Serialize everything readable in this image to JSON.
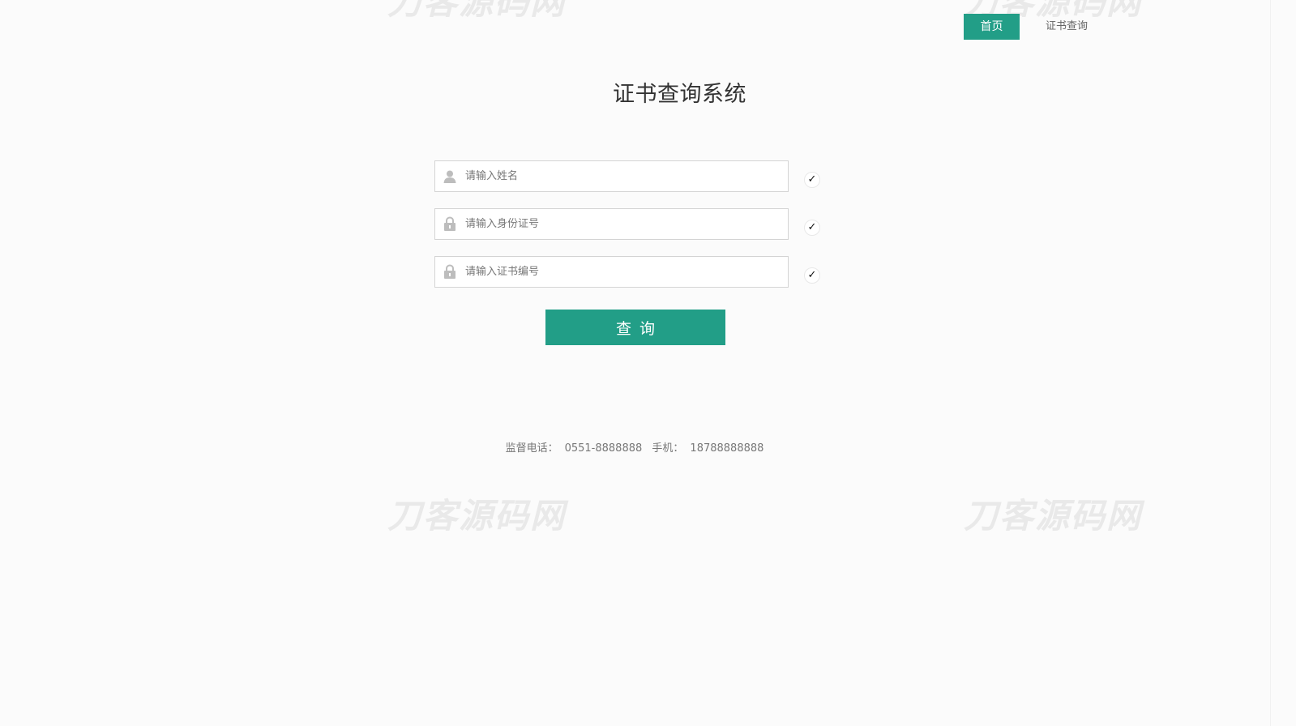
{
  "watermark": {
    "text": "刀客源码网"
  },
  "nav": {
    "home": "首页",
    "query": "证书查询"
  },
  "page": {
    "title": "证书查询系统"
  },
  "form": {
    "name": {
      "placeholder": "请输入姓名",
      "icon": "user-icon"
    },
    "id_number": {
      "placeholder": "请输入身份证号",
      "icon": "lock-icon"
    },
    "cert_number": {
      "placeholder": "请输入证书编号",
      "icon": "lock-icon"
    },
    "check_mark": "✓",
    "submit_label": "查询"
  },
  "footer": {
    "phone_label": "监督电话：",
    "phone": "0551-8888888",
    "mobile_label": "手机：",
    "mobile": "18788888888"
  },
  "colors": {
    "accent": "#229e87",
    "background": "#fbfbfb"
  }
}
